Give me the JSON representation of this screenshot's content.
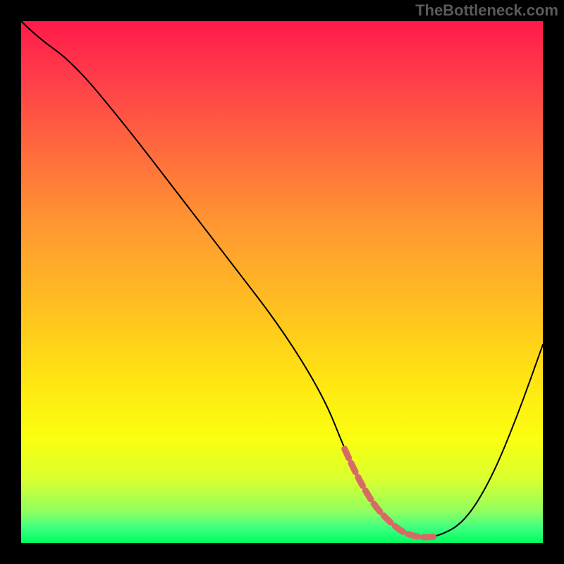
{
  "watermark": "TheBottleneck.com",
  "chart_data": {
    "type": "line",
    "title": "",
    "xlabel": "",
    "ylabel": "",
    "xlim": [
      0,
      100
    ],
    "ylim": [
      0,
      100
    ],
    "series": [
      {
        "name": "bottleneck-curve",
        "x": [
          0,
          3,
          10,
          20,
          30,
          40,
          50,
          58,
          62,
          66,
          72,
          76,
          80,
          85,
          90,
          95,
          100
        ],
        "y": [
          100,
          97,
          92,
          80,
          67,
          54,
          41,
          28,
          18,
          9,
          2.5,
          1,
          1.2,
          4,
          12,
          24,
          38
        ]
      }
    ],
    "annotations": [
      {
        "name": "valley-highlight",
        "color": "#d86a66",
        "segment_start_x": 62,
        "segment_end_x": 82
      }
    ]
  },
  "plot": {
    "inner_left": 30,
    "inner_top": 30,
    "inner_w": 740,
    "inner_h": 740
  }
}
